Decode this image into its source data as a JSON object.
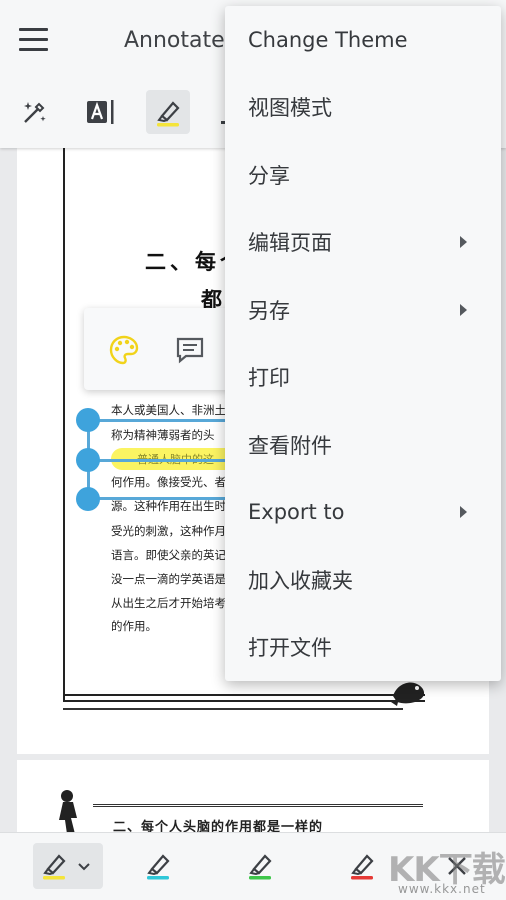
{
  "app": {
    "title": "Annotate"
  },
  "document": {
    "heading_line1": "二、每个",
    "heading_line2": "都",
    "body_lines": [
      "本人或美国人、非洲土",
      "称为精神薄弱者的头",
      "何作用。像接受光、者",
      "源。这种作用在出生时",
      "受光的刺激，这种作月",
      "语言。即使父亲的英记",
      "没一点一滴的学英语是",
      "从出生之后才开始培考",
      "的作用。"
    ],
    "highlighted_text": "普通人脑中的这",
    "page2_title": "二、每个人头脑的作用都是一样的"
  },
  "menu": {
    "items": [
      {
        "label": "Change Theme",
        "submenu": false
      },
      {
        "label": "视图模式",
        "submenu": false
      },
      {
        "label": "分享",
        "submenu": false
      },
      {
        "label": "编辑页面",
        "submenu": true
      },
      {
        "label": "另存",
        "submenu": true
      },
      {
        "label": "打印",
        "submenu": false
      },
      {
        "label": "查看附件",
        "submenu": false
      },
      {
        "label": "Export to",
        "submenu": true
      },
      {
        "label": "加入收藏夹",
        "submenu": false
      },
      {
        "label": "打开文件",
        "submenu": false
      }
    ]
  },
  "toolbar": {
    "icons": [
      "magic-pen-icon",
      "text-cursor-icon",
      "highlighter-icon"
    ],
    "highlight_colors": {
      "yellow": "#f4e43a",
      "cyan": "#2fc7d8",
      "green": "#3ec64a",
      "red": "#e53935"
    }
  },
  "watermark": {
    "brand": "KK下载",
    "url": "www.kkx.net"
  },
  "colors": {
    "selection": "#3ea3dc",
    "highlight": "#fbf35a",
    "palette_icon": "#f1d31a"
  }
}
